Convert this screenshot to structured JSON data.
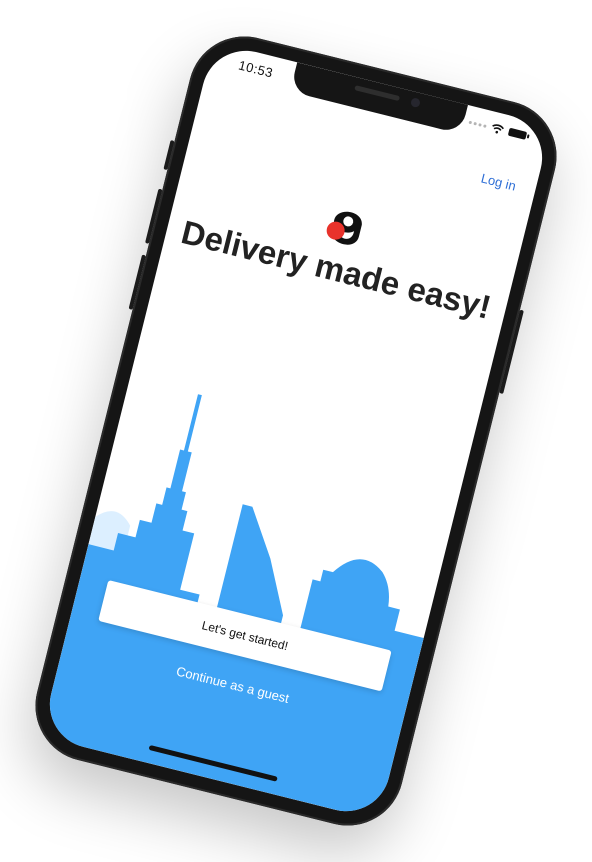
{
  "status_bar": {
    "time": "10:53"
  },
  "header": {
    "login_label": "Log in"
  },
  "hero": {
    "headline": "Delivery made easy!"
  },
  "actions": {
    "primary_label": "Let's get started!",
    "guest_label": "Continue as a guest"
  },
  "colors": {
    "accent_blue": "#3fa4f5",
    "link_blue": "#2f6fd6",
    "logo_red": "#e8322b",
    "text_dark": "#222222"
  },
  "icons": {
    "logo": "brand-logo-icon",
    "wifi": "wifi-icon",
    "battery": "battery-icon",
    "signal": "signal-icon"
  }
}
